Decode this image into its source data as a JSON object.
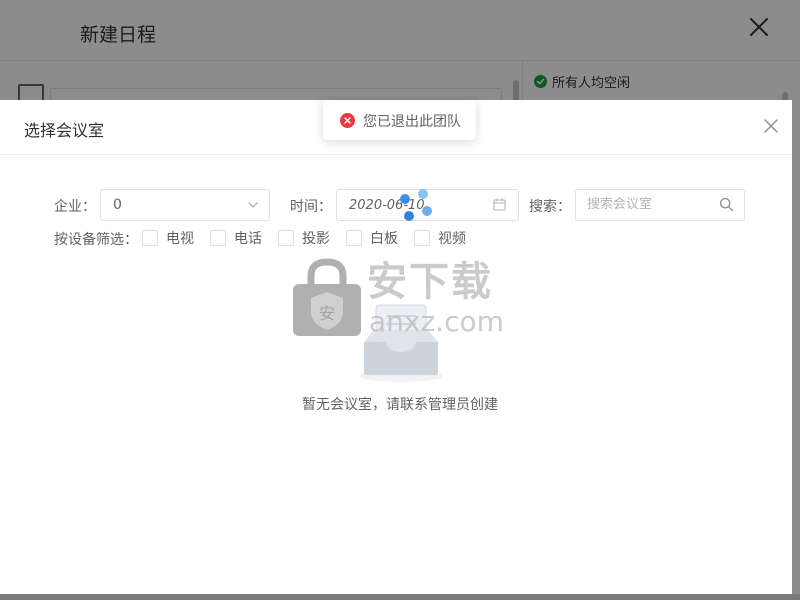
{
  "background_dialog": {
    "title": "新建日程",
    "status_text": "所有人均空闲"
  },
  "modal": {
    "title": "选择会议室",
    "filters": {
      "company_label": "企业：",
      "company_value": "0",
      "time_label": "时间：",
      "time_value": "2020-06-10",
      "search_label": "搜索：",
      "search_placeholder": "搜索会议室",
      "device_label": "按设备筛选：",
      "devices": [
        {
          "label": "电视",
          "checked": false
        },
        {
          "label": "电话",
          "checked": false
        },
        {
          "label": "投影",
          "checked": false
        },
        {
          "label": "白板",
          "checked": false
        },
        {
          "label": "视频",
          "checked": false
        }
      ]
    },
    "empty_text": "暂无会议室，请联系管理员创建"
  },
  "toast": {
    "message": "您已退出此团队",
    "type": "error"
  },
  "watermark": {
    "text_top": "安下载",
    "text_bottom": "anxz.com"
  },
  "colors": {
    "error": "#e63946",
    "success": "#1a9e3a",
    "spinner": "#3a8ee6"
  }
}
